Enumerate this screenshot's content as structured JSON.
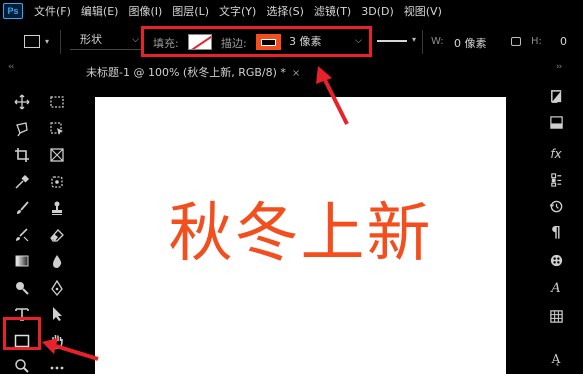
{
  "app": {
    "logo": "Ps"
  },
  "menu": [
    "文件(F)",
    "编辑(E)",
    "图像(I)",
    "图层(L)",
    "文字(Y)",
    "选择(S)",
    "滤镜(T)",
    "3D(D)",
    "视图(V)"
  ],
  "options": {
    "tool_mode": "形状",
    "fill_label": "填充:",
    "stroke_label": "描边:",
    "stroke_size": "3 像素",
    "width_label": "W:",
    "width_value": "0 像素",
    "height_label": "H:",
    "height_value": "0"
  },
  "document": {
    "tab_title": "未标题-1 @ 100% (秋冬上新, RGB/8) *",
    "close": "×",
    "canvas_text": "秋冬上新"
  },
  "colors": {
    "accent": "#f24e1e",
    "highlight": "#e8222b",
    "background": "#000000",
    "canvas": "#ffffff"
  },
  "icons": {
    "left_toolbar": [
      "move-icon",
      "marquee-icon",
      "lasso-icon",
      "object-select-icon",
      "crop-icon",
      "frame-icon",
      "eyedropper-icon",
      "spot-heal-icon",
      "brush-icon",
      "stamp-icon",
      "history-brush-icon",
      "eraser-icon",
      "gradient-icon",
      "blur-icon",
      "dodge-icon",
      "pen-icon",
      "type-icon",
      "path-select-icon",
      "rectangle-icon",
      "hand-icon",
      "zoom-icon",
      "more-icon"
    ],
    "right_panel": [
      "color-icon",
      "swatches-icon",
      "fx-icon",
      "adjustments-icon",
      "history-icon",
      "paragraph-icon",
      "brushes-icon",
      "character-icon",
      "table-icon",
      "glyphs-icon"
    ]
  }
}
